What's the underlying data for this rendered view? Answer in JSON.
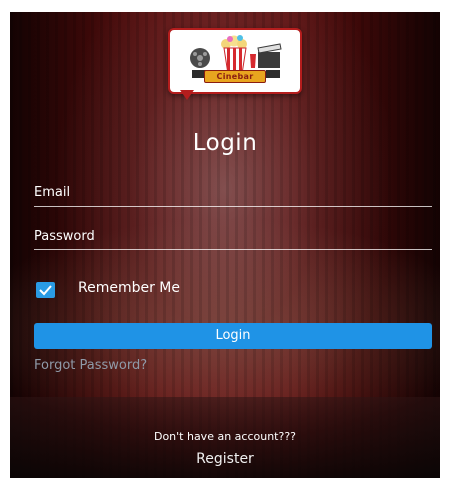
{
  "logo": {
    "text": "Cinebar"
  },
  "title": "Login",
  "form": {
    "email_label": "Email",
    "password_label": "Password",
    "remember_label": "Remember Me",
    "remember_checked": true,
    "login_button": "Login",
    "forgot_password": "Forgot Password?"
  },
  "footer": {
    "no_account": "Don't have an account???",
    "register": "Register"
  },
  "colors": {
    "accent_blue": "#1f93e6",
    "background_red": "#6a1616",
    "logo_border": "#b51d1d"
  }
}
